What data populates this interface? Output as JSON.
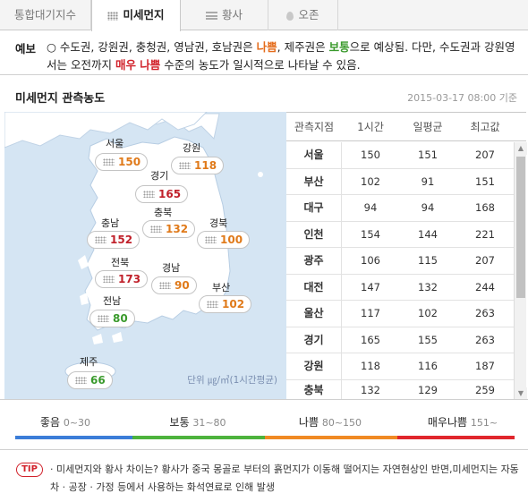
{
  "tabs": [
    {
      "label": "통합대기지수",
      "icon": ""
    },
    {
      "label": "미세먼지",
      "icon": "dots-icon"
    },
    {
      "label": "황사",
      "icon": "lines-icon"
    },
    {
      "label": "오존",
      "icon": "drop-icon"
    }
  ],
  "forecast": {
    "label": "예보",
    "part1": "○ 수도권, 강원권, 충청권, 영남권, 호남권은 ",
    "grade1": "나쁨",
    "part2": ", 제주권은 ",
    "grade2": "보통",
    "part3": "으로 예상됨. 다만, 수도권과 강원영서는 오전까지 ",
    "grade3": "매우 나쁨",
    "part4": " 수준의 농도가 일시적으로 나타날 수 있음."
  },
  "section": {
    "title": "미세먼지 관측농도",
    "datetime": "2015-03-17 08:00 기준"
  },
  "map": {
    "regions": [
      {
        "name": "서울",
        "value": "150",
        "level": "bad"
      },
      {
        "name": "강원",
        "value": "118",
        "level": "bad"
      },
      {
        "name": "경기",
        "value": "165",
        "level": "very_bad"
      },
      {
        "name": "충북",
        "value": "132",
        "level": "bad"
      },
      {
        "name": "충남",
        "value": "152",
        "level": "very_bad"
      },
      {
        "name": "경북",
        "value": "100",
        "level": "bad"
      },
      {
        "name": "전북",
        "value": "173",
        "level": "very_bad"
      },
      {
        "name": "경남",
        "value": "90",
        "level": "bad"
      },
      {
        "name": "부산",
        "value": "102",
        "level": "bad"
      },
      {
        "name": "전남",
        "value": "80",
        "level": "normal"
      },
      {
        "name": "제주",
        "value": "66",
        "level": "normal"
      }
    ],
    "unit_note": "단위 ㎍/㎥(1시간평균)"
  },
  "table": {
    "headers": [
      "관측지점",
      "1시간",
      "일평균",
      "최고값"
    ],
    "rows": [
      [
        "서울",
        "150",
        "151",
        "207"
      ],
      [
        "부산",
        "102",
        "91",
        "151"
      ],
      [
        "대구",
        "94",
        "94",
        "168"
      ],
      [
        "인천",
        "154",
        "144",
        "221"
      ],
      [
        "광주",
        "106",
        "115",
        "207"
      ],
      [
        "대전",
        "147",
        "132",
        "244"
      ],
      [
        "울산",
        "117",
        "102",
        "263"
      ],
      [
        "경기",
        "165",
        "155",
        "263"
      ],
      [
        "강원",
        "118",
        "116",
        "187"
      ],
      [
        "충북",
        "132",
        "129",
        "259"
      ]
    ]
  },
  "legend": [
    {
      "label": "좋음",
      "range": "0~30",
      "color": "#3b7dd8"
    },
    {
      "label": "보통",
      "range": "31~80",
      "color": "#4db33d"
    },
    {
      "label": "나쁨",
      "range": "80~150",
      "color": "#f08a24"
    },
    {
      "label": "매우나쁨",
      "range": "151~",
      "color": "#e0262d"
    }
  ],
  "tip": {
    "badge": "TIP",
    "text": "· 미세먼지와 황사 차이는? 황사가 중국 몽골로 부터의 흙먼지가 이동해 떨어지는 자연현상인 반면,미세먼지는 자동차 · 공장 · 가정 등에서 사용하는 화석연료로 인해 발생"
  },
  "colors": {
    "bad": "#e07a1a",
    "very_bad": "#c0202a",
    "normal": "#3a9a2c",
    "sea": "#d5e5f3",
    "land": "#ffffff"
  }
}
